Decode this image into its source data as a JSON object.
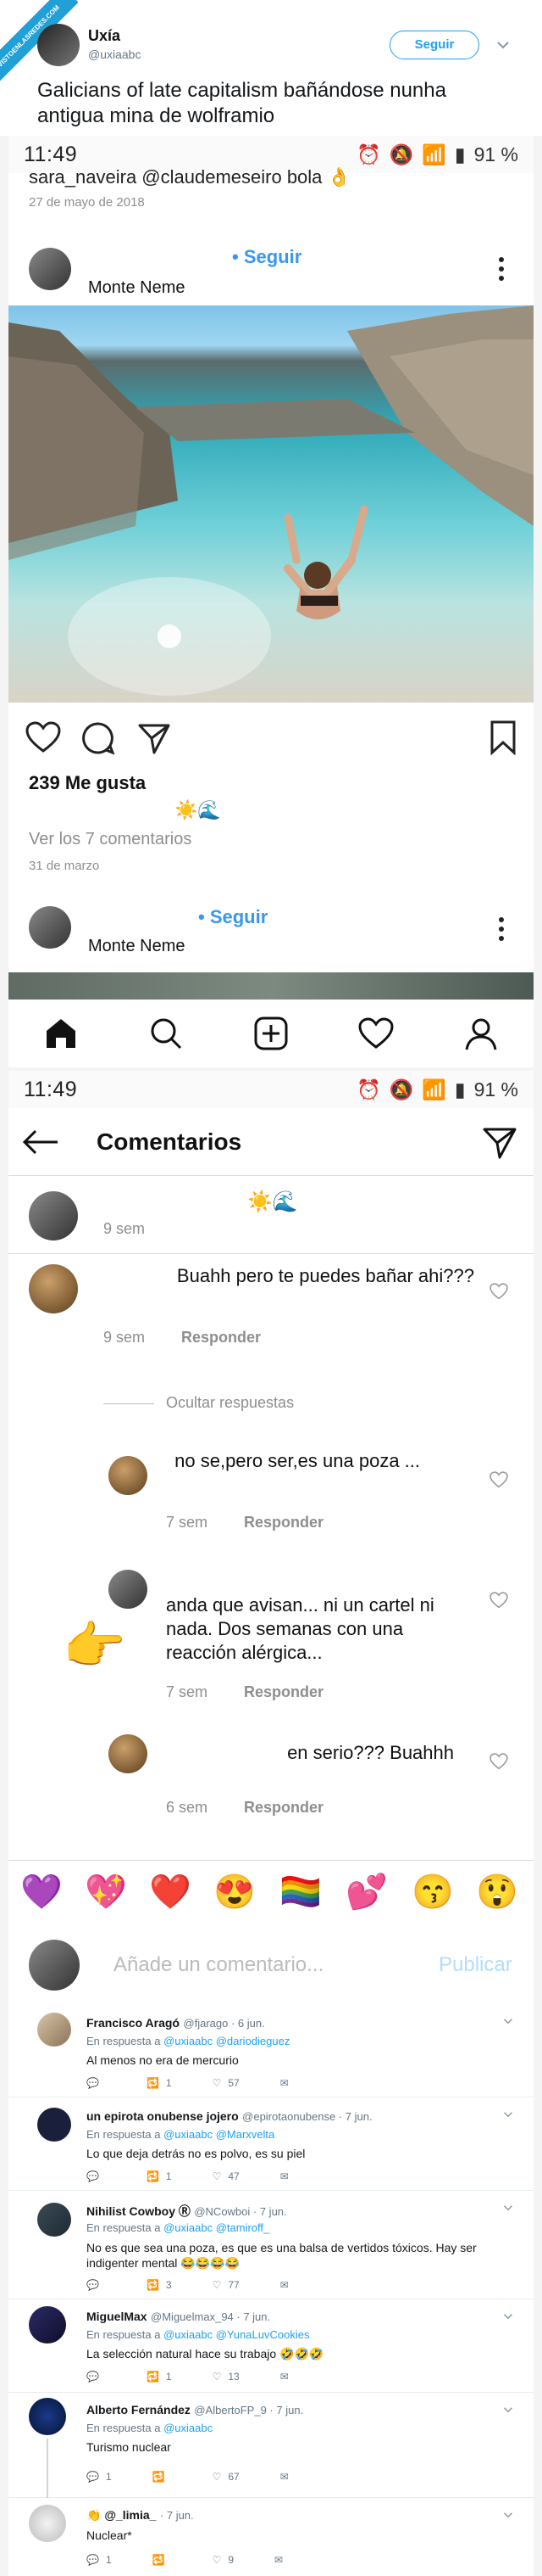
{
  "header": {
    "name": "Uxía",
    "handle": "@uxiaabc",
    "follow_label": "Seguir",
    "watermark": "VISTOENLASREDES.COM",
    "tweet_text": "Galicians of late capitalism bañándose nunha antigua mina de wolframio"
  },
  "status1": {
    "time": "11:49",
    "battery": "91 %"
  },
  "ig_post": {
    "prev_comment": "sara_naveira @claudemeseiro bola 👌",
    "prev_date": "27 de mayo de 2018",
    "follow_label": "• Seguir",
    "location": "Monte Neme",
    "likes": "239 Me gusta",
    "caption_emojis": "☀️🌊",
    "view_comments": "Ver los 7 comentarios",
    "date": "31 de marzo",
    "next_follow_label": "• Seguir",
    "next_location": "Monte Neme"
  },
  "status2": {
    "time": "11:49",
    "battery": "91 %"
  },
  "comments_view": {
    "title": "Comentarios",
    "caption": {
      "emojis": "☀️🌊",
      "time": "9 sem"
    },
    "comments": [
      {
        "text": "Buahh pero te puedes bañar ahi???",
        "time": "9 sem",
        "reply": "Responder"
      }
    ],
    "hide_replies": "Ocultar respuestas",
    "replies": [
      {
        "text": "no se,pero ser,es una poza ...",
        "time": "7 sem",
        "reply": "Responder"
      },
      {
        "text": "anda que avisan... ni un cartel ni nada. Dos semanas con una reacción alérgica...",
        "time": "7 sem",
        "reply": "Responder"
      },
      {
        "text": "en serio??? Buahhh",
        "time": "6 sem",
        "reply": "Responder"
      }
    ],
    "pointer_emoji": "👉",
    "reactions": [
      "💜",
      "💖",
      "❤️",
      "😍",
      "🏳️‍🌈",
      "💕",
      "😙",
      "😲"
    ],
    "input_placeholder": "Añade un comentario...",
    "publish_label": "Publicar"
  },
  "twitter_replies": [
    {
      "name": "Francisco Aragó",
      "handle": "@fjarago · 6 jun.",
      "reply_prefix": "En respuesta a",
      "reply_to": "@uxiaabc @dariodieguez",
      "text": "Al menos no era de mercurio",
      "replies": "",
      "retweets": "1",
      "likes": "57"
    },
    {
      "name": "un epirota onubense jojero",
      "handle": "@epirotaonubense · 7 jun.",
      "reply_prefix": "En respuesta a",
      "reply_to": "@uxiaabc @Marxvelta",
      "text": "Lo que deja detrás no es polvo, es su piel",
      "replies": "",
      "retweets": "1",
      "likes": "47"
    },
    {
      "name": "Nihilist Cowboy Ⓡ",
      "handle": "@NCowboi · 7 jun.",
      "reply_prefix": "En respuesta a",
      "reply_to": "@uxiaabc @tamiroff_",
      "text": "No es que sea una poza, es que es una balsa de vertidos tóxicos. Hay ser indigenter mental 😂😂😂😂",
      "replies": "",
      "retweets": "3",
      "likes": "77"
    },
    {
      "name": "MiguelMax",
      "handle": "@Miguelmax_94 · 7 jun.",
      "reply_prefix": "En respuesta a",
      "reply_to": "@uxiaabc @YunaLuvCookies",
      "text": "La selección natural hace su trabajo 🤣🤣🤣",
      "replies": "",
      "retweets": "1",
      "likes": "13"
    },
    {
      "name": "Alberto Fernández",
      "handle": "@AlbertoFP_9 · 7 jun.",
      "reply_prefix": "En respuesta a",
      "reply_to": "@uxiaabc",
      "text": "Turismo nuclear",
      "replies": "1",
      "retweets": "",
      "likes": "67"
    },
    {
      "name": "👏 @_limia_",
      "handle": "· 7 jun.",
      "reply_prefix": "",
      "reply_to": "",
      "text": "Nuclear*",
      "replies": "1",
      "retweets": "",
      "likes": "9"
    }
  ]
}
